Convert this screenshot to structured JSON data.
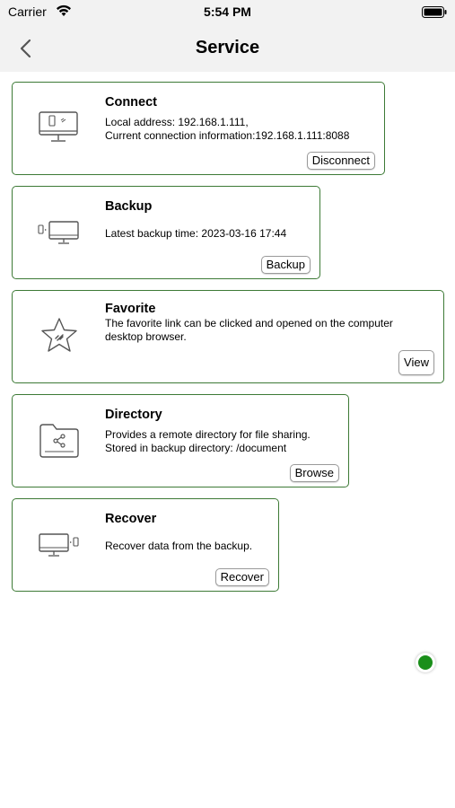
{
  "status": {
    "carrier": "Carrier",
    "time": "5:54 PM"
  },
  "nav": {
    "title": "Service"
  },
  "cards": [
    {
      "title": "Connect",
      "desc1": "Local address: 192.168.1.111,",
      "desc2": "Current connection information:192.168.1.111:8088",
      "button": "Disconnect",
      "icon": "computer-phone-icon"
    },
    {
      "title": "Backup",
      "desc1": "Latest backup time: 2023-03-16 17:44",
      "button": "Backup",
      "icon": "phone-to-computer-icon"
    },
    {
      "title": "Favorite",
      "desc1": "The favorite link can be clicked and opened on the computer",
      "desc2": "desktop browser.",
      "button": "View",
      "icon": "star-link-icon"
    },
    {
      "title": "Directory",
      "desc1": "Provides a remote directory for file sharing.",
      "desc2": "Stored in backup directory: /document",
      "button": "Browse",
      "icon": "shared-folder-icon"
    },
    {
      "title": "Recover",
      "desc1": "Recover data from the backup.",
      "button": "Recover",
      "icon": "computer-to-phone-icon"
    }
  ],
  "colors": {
    "card_border": "#3d7a36",
    "status_dot": "#1a8f1a",
    "bar_bg": "#f2f2f2"
  }
}
